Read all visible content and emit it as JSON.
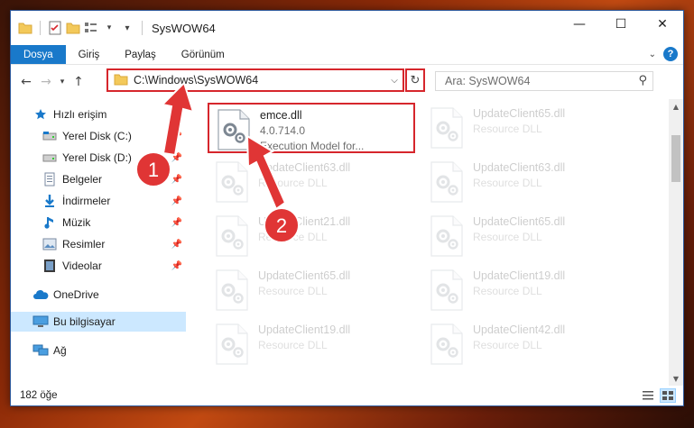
{
  "window": {
    "title": "SysWOW64"
  },
  "ribbon": {
    "tabs": [
      {
        "label": "Dosya"
      },
      {
        "label": "Giriş"
      },
      {
        "label": "Paylaş"
      },
      {
        "label": "Görünüm"
      }
    ]
  },
  "address": {
    "path": "C:\\Windows\\SysWOW64"
  },
  "search": {
    "placeholder": "Ara: SysWOW64"
  },
  "nav": {
    "items": [
      {
        "label": "Hızlı erişim",
        "icon": "star-icon"
      },
      {
        "label": "Yerel Disk (C:)",
        "icon": "drive-icon",
        "pinned": true
      },
      {
        "label": "Yerel Disk (D:)",
        "icon": "drive-icon",
        "pinned": true
      },
      {
        "label": "Belgeler",
        "icon": "documents-icon",
        "pinned": true
      },
      {
        "label": "İndirmeler",
        "icon": "download-icon",
        "pinned": true
      },
      {
        "label": "Müzik",
        "icon": "music-icon",
        "pinned": true
      },
      {
        "label": "Resimler",
        "icon": "pictures-icon",
        "pinned": true
      },
      {
        "label": "Videolar",
        "icon": "videos-icon",
        "pinned": true
      },
      {
        "label": "OneDrive",
        "icon": "cloud-icon"
      },
      {
        "label": "Bu bilgisayar",
        "icon": "computer-icon",
        "selected": true
      },
      {
        "label": "Ağ",
        "icon": "network-icon"
      }
    ]
  },
  "files": [
    {
      "name": "emce.dll",
      "line2": "4.0.714.0",
      "line3": "Execution Model for...",
      "highlighted": true
    },
    {
      "name": "UpdateClient65.dll",
      "line2": "Resource DLL"
    },
    {
      "name": "UpdateClient63.dll",
      "line2": "Resource DLL"
    },
    {
      "name": "UpdateClient63.dll",
      "line2": "Resource DLL"
    },
    {
      "name": "UpdateClient21.dll",
      "line2": "Resource DLL"
    },
    {
      "name": "UpdateClient65.dll",
      "line2": "Resource DLL"
    },
    {
      "name": "UpdateClient65.dll",
      "line2": "Resource DLL"
    },
    {
      "name": "UpdateClient19.dll",
      "line2": "Resource DLL"
    },
    {
      "name": "UpdateClient19.dll",
      "line2": "Resource DLL"
    },
    {
      "name": "UpdateClient42.dll",
      "line2": "Resource DLL"
    }
  ],
  "status": {
    "count": "182 öğe"
  },
  "annotations": [
    {
      "number": "1"
    },
    {
      "number": "2"
    }
  ],
  "colors": {
    "accent": "#1979ca",
    "highlight": "#d6262c",
    "selected": "#cce8ff"
  }
}
